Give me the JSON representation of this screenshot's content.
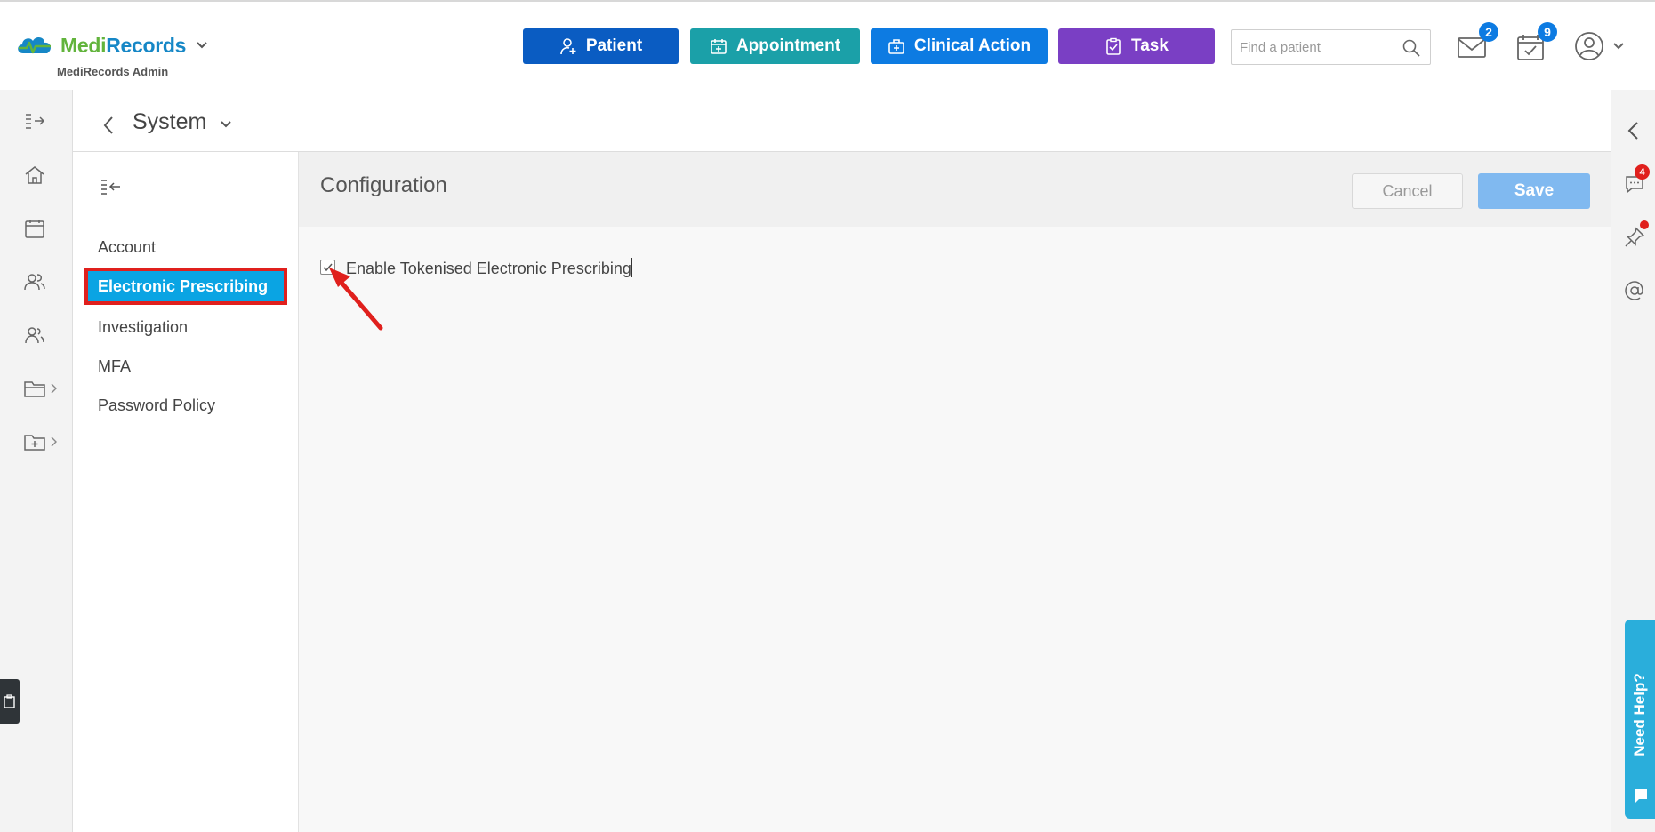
{
  "brand": {
    "name_part1": "Medi",
    "name_part2": "Records",
    "subtitle": "MediRecords Admin",
    "color_green": "#62b43c",
    "color_blue": "#1687c6"
  },
  "top_actions": {
    "patient": "Patient",
    "appointment": "Appointment",
    "clinical_action": "Clinical Action",
    "task": "Task"
  },
  "search": {
    "placeholder": "Find a patient",
    "value": ""
  },
  "notifications": {
    "mail_count": "2",
    "calendar_count": "9"
  },
  "breadcrumb": {
    "title": "System"
  },
  "settings_nav": {
    "items": [
      {
        "label": "Account",
        "active": false
      },
      {
        "label": "Electronic Prescribing",
        "active": true
      },
      {
        "label": "Investigation",
        "active": false
      },
      {
        "label": "MFA",
        "active": false
      },
      {
        "label": "Password Policy",
        "active": false
      }
    ]
  },
  "config": {
    "title": "Configuration",
    "cancel_label": "Cancel",
    "save_label": "Save",
    "option_label": "Enable Tokenised Electronic Prescribing",
    "option_checked": true
  },
  "right_rail": {
    "messages_badge": "4"
  },
  "help": {
    "label": "Need Help?"
  },
  "colors": {
    "patient_btn": "#0a5cc2",
    "appointment_btn": "#1ba0a8",
    "clinical_btn": "#0d7be2",
    "task_btn": "#7a3fc4",
    "active_nav": "#0aa4e3",
    "highlight_box": "#e0201d",
    "save_btn": "#80b9f0"
  }
}
